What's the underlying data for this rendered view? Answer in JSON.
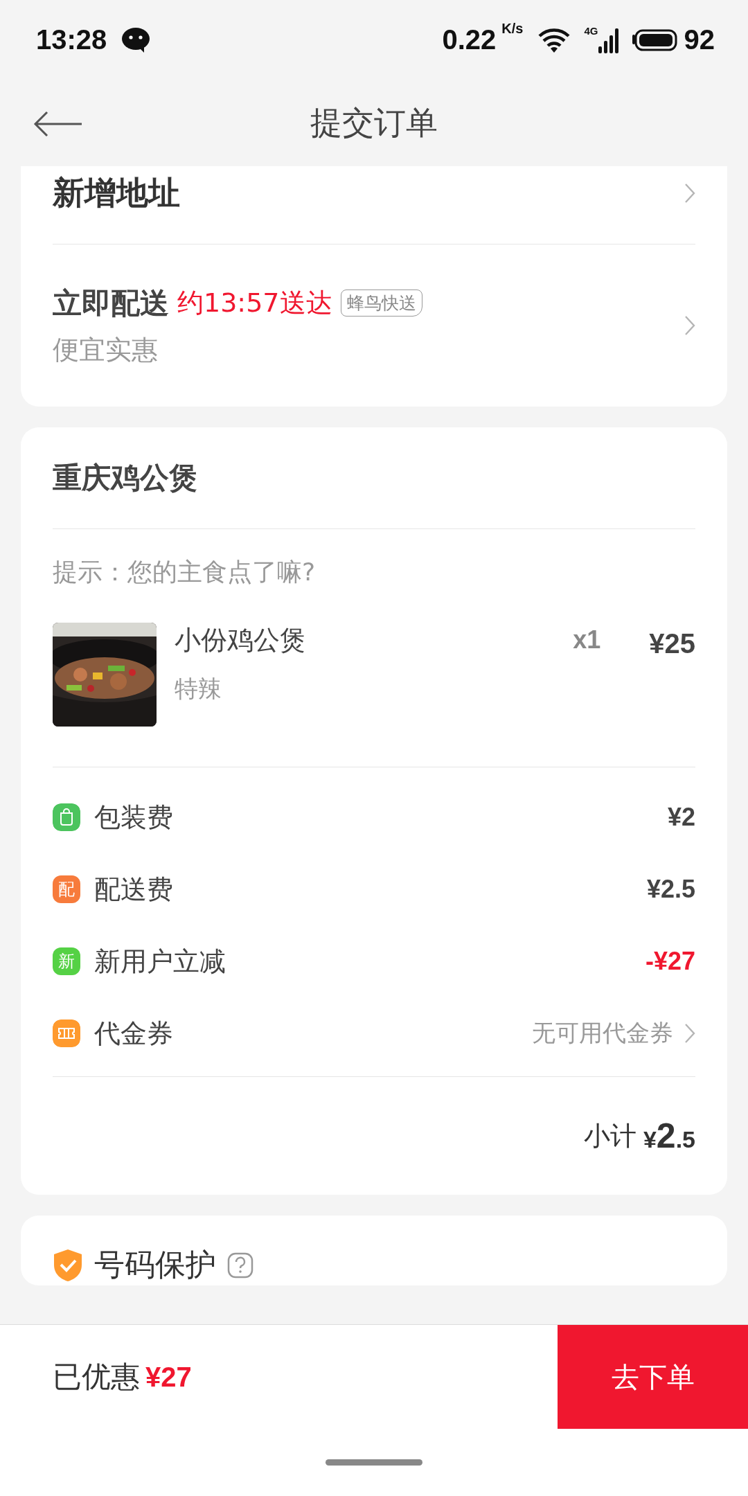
{
  "status_bar": {
    "time": "13:28",
    "speed": "0.22",
    "speed_unit": "K/s",
    "network": "4G",
    "battery": "92"
  },
  "header": {
    "title": "提交订单"
  },
  "address": {
    "label": "新增地址"
  },
  "delivery": {
    "mode": "立即配送",
    "eta": "约13:57送达",
    "courier": "蜂鸟快送",
    "note": "便宜实惠"
  },
  "shop": {
    "name": "重庆鸡公煲",
    "hint": "提示：您的主食点了嘛?",
    "items": [
      {
        "name": "小份鸡公煲",
        "spec": "特辣",
        "quantity": "x1",
        "price": "¥25"
      }
    ],
    "fees": [
      {
        "kind": "bag",
        "color": "#4cc45e",
        "label": "包装费",
        "amount": "¥2"
      },
      {
        "kind": "char",
        "color": "#f77b3c",
        "icon_text": "配",
        "label": "配送费",
        "amount": "¥2.5"
      },
      {
        "kind": "char",
        "color": "#55d145",
        "icon_text": "新",
        "label": "新用户立减",
        "amount": "-¥27",
        "negative": true
      },
      {
        "kind": "ticket",
        "color": "#ff9a2e",
        "label": "代金券",
        "value": "无可用代金券"
      }
    ],
    "subtotal": {
      "label": "小计",
      "currency": "¥",
      "integer": "2",
      "decimal": ".5"
    }
  },
  "privacy": {
    "label": "号码保护"
  },
  "bottom_bar": {
    "label": "已优惠",
    "saved": "¥27",
    "button": "去下单"
  }
}
